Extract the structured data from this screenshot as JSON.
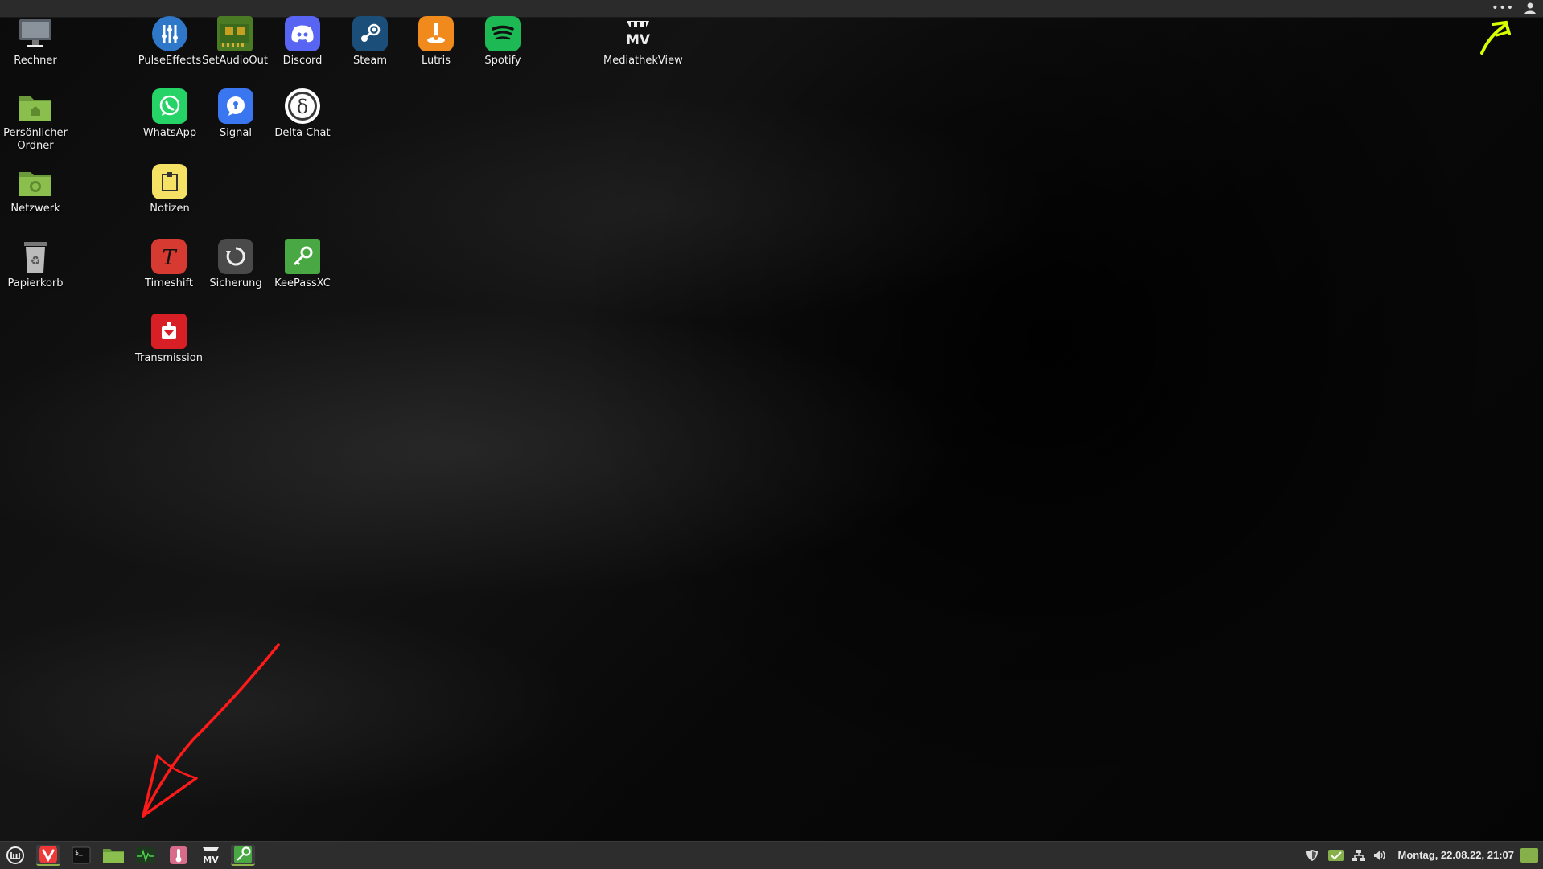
{
  "desktop": {
    "icons": [
      {
        "label": "Rechner",
        "icon": "computer-icon"
      },
      {
        "label": "Persönlicher Ordner",
        "icon": "home-folder-icon"
      },
      {
        "label": "Netzwerk",
        "icon": "network-folder-icon"
      },
      {
        "label": "Papierkorb",
        "icon": "trash-icon"
      },
      {
        "label": "PulseEffects",
        "icon": "pulseeffects-icon"
      },
      {
        "label": "SetAudioOut",
        "icon": "setaudioout-icon"
      },
      {
        "label": "Discord",
        "icon": "discord-icon"
      },
      {
        "label": "Steam",
        "icon": "steam-icon"
      },
      {
        "label": "Lutris",
        "icon": "lutris-icon"
      },
      {
        "label": "Spotify",
        "icon": "spotify-icon"
      },
      {
        "label": "MediathekView",
        "icon": "mediathekview-icon"
      },
      {
        "label": "WhatsApp",
        "icon": "whatsapp-icon"
      },
      {
        "label": "Signal",
        "icon": "signal-icon"
      },
      {
        "label": "Delta Chat",
        "icon": "deltachat-icon"
      },
      {
        "label": "Notizen",
        "icon": "notes-icon"
      },
      {
        "label": "Timeshift",
        "icon": "timeshift-icon"
      },
      {
        "label": "Sicherung",
        "icon": "backup-icon"
      },
      {
        "label": "KeePassXC",
        "icon": "keepassxc-icon"
      },
      {
        "label": "Transmission",
        "icon": "transmission-icon"
      }
    ]
  },
  "topbar": {
    "menu_dots": "•••",
    "user_icon": "user-icon"
  },
  "taskbar": {
    "launchers": [
      {
        "name": "mint-menu-icon"
      },
      {
        "name": "vivaldi-icon"
      },
      {
        "name": "terminal-icon"
      },
      {
        "name": "files-icon"
      },
      {
        "name": "system-monitor-icon"
      },
      {
        "name": "thermometer-icon"
      },
      {
        "name": "mediathekview-icon"
      },
      {
        "name": "keepassxc-icon"
      }
    ],
    "tray": [
      "shield-icon",
      "update-manager-icon",
      "network-icon",
      "volume-icon"
    ],
    "clock": "Montag, 22.08.22, 21:07"
  },
  "colors": {
    "taskbar_bg": "#2d2d2d",
    "accent": "#8fb34a",
    "annotation_red": "#ff1a1a",
    "annotation_yellow": "#d8ff00"
  }
}
